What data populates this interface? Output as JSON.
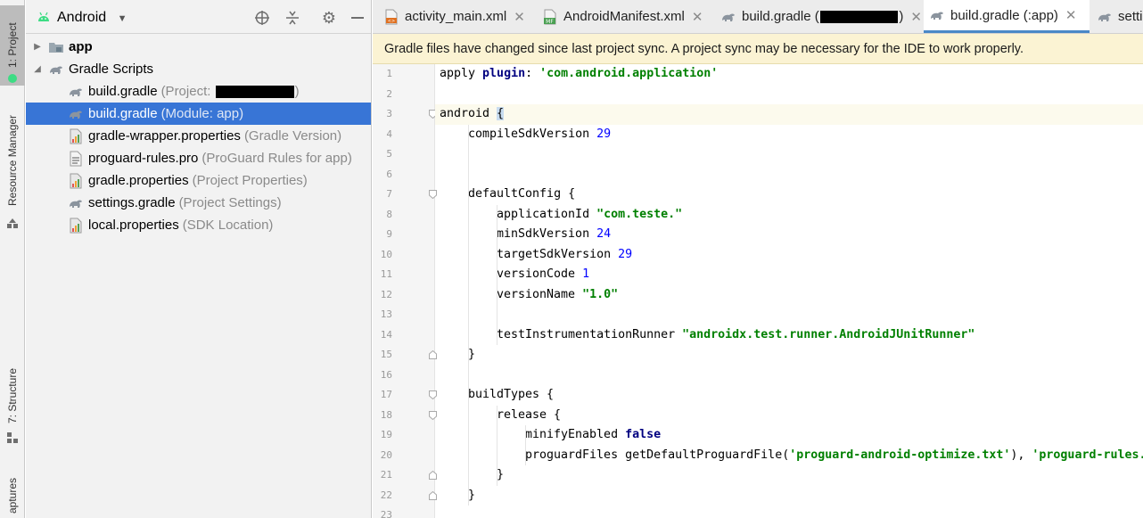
{
  "side_strip": {
    "tabs": [
      "1: Project",
      "Resource Manager",
      "7: Structure",
      "aptures"
    ]
  },
  "project_panel": {
    "view_selector": "Android",
    "tree": [
      {
        "name": "app",
        "detail": "",
        "kind": "folder",
        "level": 0,
        "expanded": false
      },
      {
        "name": "Gradle Scripts",
        "detail": "",
        "kind": "gradle-folder",
        "level": 0,
        "expanded": true
      },
      {
        "name": "build.gradle",
        "detail": "(Project: ",
        "detail_end": ")",
        "kind": "gradle",
        "level": 1,
        "redacted": true
      },
      {
        "name": "build.gradle",
        "detail": "(Module: app)",
        "kind": "gradle",
        "level": 1,
        "selected": true
      },
      {
        "name": "gradle-wrapper.properties",
        "detail": "(Gradle Version)",
        "kind": "properties",
        "level": 1
      },
      {
        "name": "proguard-rules.pro",
        "detail": "(ProGuard Rules for app)",
        "kind": "text",
        "level": 1
      },
      {
        "name": "gradle.properties",
        "detail": "(Project Properties)",
        "kind": "properties",
        "level": 1
      },
      {
        "name": "settings.gradle",
        "detail": "(Project Settings)",
        "kind": "gradle",
        "level": 1
      },
      {
        "name": "local.properties",
        "detail": "(SDK Location)",
        "kind": "properties",
        "level": 1
      }
    ]
  },
  "editor": {
    "tabs": [
      {
        "label": "activity_main.xml",
        "icon": "xml-file-icon",
        "active": false
      },
      {
        "label": "AndroidManifest.xml",
        "icon": "manifest-file-icon",
        "active": false
      },
      {
        "label": "build.gradle (",
        "label_end": ")",
        "icon": "gradle-icon",
        "active": false,
        "redacted": true
      },
      {
        "label": "build.gradle (:app)",
        "icon": "gradle-icon",
        "active": true
      },
      {
        "label": "setti",
        "icon": "gradle-icon",
        "active": false
      }
    ],
    "banner": "Gradle files have changed since last project sync. A project sync may be necessary for the IDE to work properly.",
    "current_line": 3,
    "lines": [
      {
        "n": "1",
        "indent": 0,
        "parts": [
          [
            "t",
            "apply "
          ],
          [
            "kw",
            "plugin"
          ],
          [
            "t",
            ": "
          ],
          [
            "str",
            "'com.android.application'"
          ]
        ]
      },
      {
        "n": "2",
        "indent": 0,
        "parts": []
      },
      {
        "n": "3",
        "indent": 0,
        "parts": [
          [
            "t",
            "android "
          ],
          [
            "hl",
            "{"
          ]
        ]
      },
      {
        "n": "4",
        "indent": 1,
        "parts": [
          [
            "t",
            "compileSdkVersion "
          ],
          [
            "num",
            "29"
          ]
        ]
      },
      {
        "n": "5",
        "indent": 0,
        "parts": []
      },
      {
        "n": "6",
        "indent": 0,
        "parts": []
      },
      {
        "n": "7",
        "indent": 1,
        "parts": [
          [
            "t",
            "defaultConfig {"
          ]
        ]
      },
      {
        "n": "8",
        "indent": 2,
        "parts": [
          [
            "t",
            "applicationId "
          ],
          [
            "str",
            "\"com.teste.\""
          ]
        ]
      },
      {
        "n": "9",
        "indent": 2,
        "parts": [
          [
            "t",
            "minSdkVersion "
          ],
          [
            "num",
            "24"
          ]
        ]
      },
      {
        "n": "10",
        "indent": 2,
        "parts": [
          [
            "t",
            "targetSdkVersion "
          ],
          [
            "num",
            "29"
          ]
        ]
      },
      {
        "n": "11",
        "indent": 2,
        "parts": [
          [
            "t",
            "versionCode "
          ],
          [
            "num",
            "1"
          ]
        ]
      },
      {
        "n": "12",
        "indent": 2,
        "parts": [
          [
            "t",
            "versionName "
          ],
          [
            "str",
            "\"1.0\""
          ]
        ]
      },
      {
        "n": "13",
        "indent": 0,
        "parts": []
      },
      {
        "n": "14",
        "indent": 2,
        "parts": [
          [
            "t",
            "testInstrumentationRunner "
          ],
          [
            "str",
            "\"androidx.test.runner.AndroidJUnitRunner\""
          ]
        ]
      },
      {
        "n": "15",
        "indent": 1,
        "parts": [
          [
            "t",
            "}"
          ]
        ]
      },
      {
        "n": "16",
        "indent": 0,
        "parts": []
      },
      {
        "n": "17",
        "indent": 1,
        "parts": [
          [
            "t",
            "buildTypes {"
          ]
        ]
      },
      {
        "n": "18",
        "indent": 2,
        "parts": [
          [
            "t",
            "release {"
          ]
        ]
      },
      {
        "n": "19",
        "indent": 3,
        "parts": [
          [
            "t",
            "minifyEnabled "
          ],
          [
            "kw",
            "false"
          ]
        ]
      },
      {
        "n": "20",
        "indent": 3,
        "parts": [
          [
            "t",
            "proguardFiles getDefaultProguardFile("
          ],
          [
            "str",
            "'proguard-android-optimize.txt'"
          ],
          [
            "t",
            "), "
          ],
          [
            "str",
            "'proguard-rules."
          ]
        ]
      },
      {
        "n": "21",
        "indent": 2,
        "parts": [
          [
            "t",
            "}"
          ]
        ]
      },
      {
        "n": "22",
        "indent": 1,
        "parts": [
          [
            "t",
            "}"
          ]
        ]
      },
      {
        "n": "23",
        "indent": 0,
        "parts": []
      }
    ]
  }
}
